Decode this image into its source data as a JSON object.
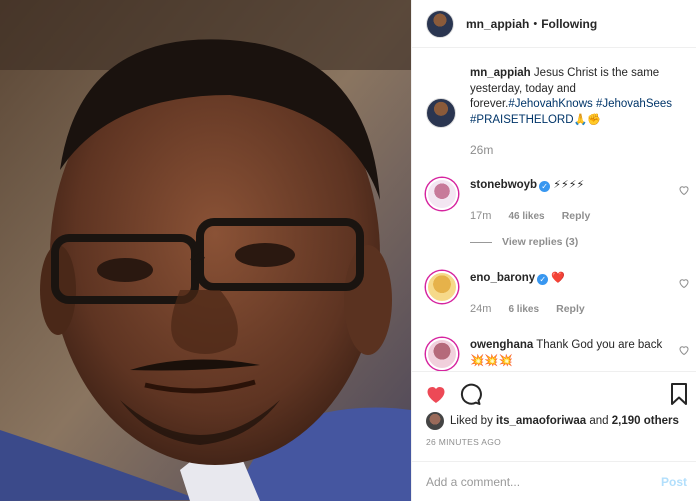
{
  "header": {
    "username": "mn_appiah",
    "separator": "•",
    "follow_status": "Following"
  },
  "caption": {
    "username": "mn_appiah",
    "text": "Jesus Christ is the same yesterday, today and forever.",
    "hashtags": "#JehovahKnows #JehovahSees #PRAISETHELORD",
    "emoji": "🙏✊",
    "time": "26m"
  },
  "comments": [
    {
      "username": "stonebwoyb",
      "verified": true,
      "text": "⚡⚡⚡⚡",
      "time": "17m",
      "likes": "46 likes",
      "reply": "Reply"
    },
    {
      "username": "eno_barony",
      "verified": true,
      "text": "❤️",
      "time": "24m",
      "likes": "6 likes",
      "reply": "Reply"
    },
    {
      "username": "owenghana",
      "verified": false,
      "text": "Thank God you are back 💥💥💥"
    }
  ],
  "view_replies": "View replies (3)",
  "likes": {
    "prefix": "Liked by",
    "user": "its_amaoforiwaa",
    "and": "and",
    "others": "2,190 others"
  },
  "posted": "26 MINUTES AGO",
  "comment_box": {
    "placeholder": "Add a comment...",
    "post_label": "Post"
  },
  "colors": {
    "heart_liked": "#ed4956",
    "link": "#003569",
    "verified": "#3897f0",
    "post_disabled": "#b2dffc"
  },
  "icons": [
    "heart-icon",
    "comment-icon",
    "bookmark-icon",
    "verified-icon"
  ]
}
